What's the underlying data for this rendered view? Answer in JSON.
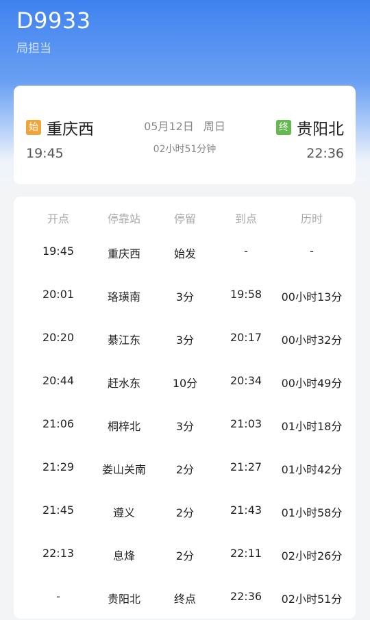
{
  "header": {
    "train_no": "D9933",
    "bureau": "局担当"
  },
  "summary": {
    "from": {
      "badge": "始",
      "name": "重庆西",
      "time": "19:45"
    },
    "to": {
      "badge": "终",
      "name": "贵阳北",
      "time": "22:36"
    },
    "date": "05月12日",
    "weekday": "周日",
    "duration": "02小时51分钟"
  },
  "table": {
    "headers": [
      "开点",
      "停靠站",
      "停留",
      "到点",
      "历时"
    ],
    "rows": [
      [
        "19:45",
        "重庆西",
        "始发",
        "-",
        "-"
      ],
      [
        "20:01",
        "珞璜南",
        "3分",
        "19:58",
        "00小时13分"
      ],
      [
        "20:20",
        "綦江东",
        "3分",
        "20:17",
        "00小时32分"
      ],
      [
        "20:44",
        "赶水东",
        "10分",
        "20:34",
        "00小时49分"
      ],
      [
        "21:06",
        "桐梓北",
        "3分",
        "21:03",
        "01小时18分"
      ],
      [
        "21:29",
        "娄山关南",
        "2分",
        "21:27",
        "01小时42分"
      ],
      [
        "21:45",
        "遵义",
        "2分",
        "21:43",
        "01小时58分"
      ],
      [
        "22:13",
        "息烽",
        "2分",
        "22:11",
        "02小时26分"
      ],
      [
        "-",
        "贵阳北",
        "终点",
        "22:36",
        "02小时51分"
      ]
    ]
  },
  "colors": {
    "header_blue": "#3f82ef",
    "badge_start": "#f0a53a",
    "badge_end": "#63b84e"
  }
}
